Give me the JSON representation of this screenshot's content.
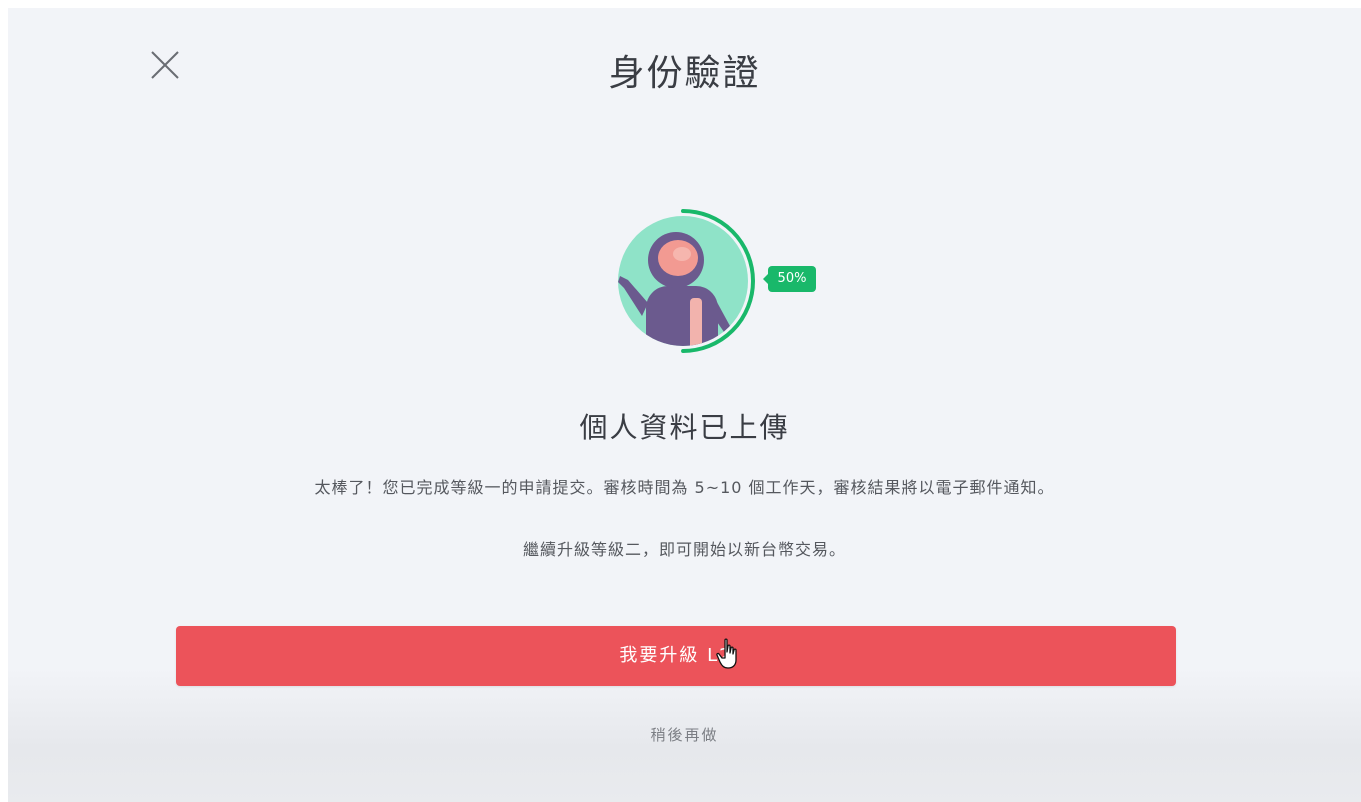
{
  "header": {
    "title": "身份驗證",
    "close_icon": "close-icon"
  },
  "status": {
    "progress_label": "50%",
    "progress_value": 0.5,
    "heading": "個人資料已上傳",
    "description_line1": "太棒了！您已完成等級一的申請提交。審核時間為 5~10 個工作天，審核結果將以電子郵件通知。",
    "description_line2": "繼續升級等級二，即可開始以新台幣交易。"
  },
  "actions": {
    "upgrade_label": "我要升級 L2",
    "later_label": "稍後再做"
  },
  "colors": {
    "accent": "#ec535a",
    "progress": "#19b86a",
    "avatar_bg": "#8fe3c8",
    "suit": "#6b5a8e",
    "visor": "#f29a92"
  }
}
